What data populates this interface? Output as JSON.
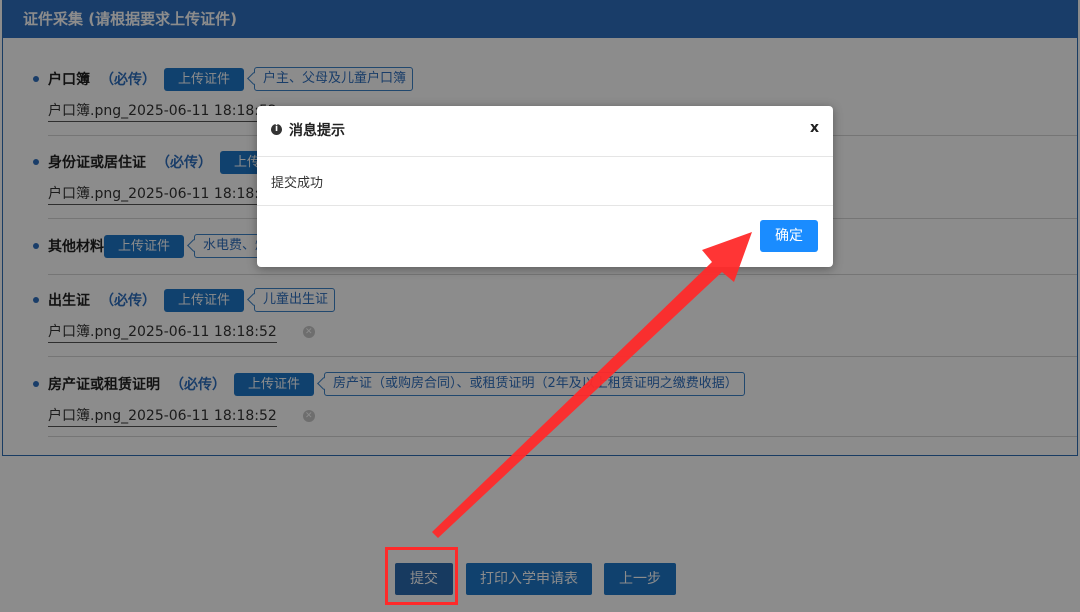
{
  "panel": {
    "title": "证件采集 (请根据要求上传证件)"
  },
  "sections": [
    {
      "name": "户口簿",
      "required": "（必传）",
      "upload_label": "上传证件",
      "hint": "户主、父母及儿童户口簿",
      "file": "户口簿.png_2025-06-11 18:18:52"
    },
    {
      "name": "身份证或居住证",
      "required": "（必传）",
      "upload_label": "上传证件",
      "hint": "",
      "file": "户口簿.png_2025-06-11 18:18:52"
    },
    {
      "name": "其他材料",
      "required": "",
      "upload_label": "上传证件",
      "hint": "水电费、煤",
      "file": ""
    },
    {
      "name": "出生证",
      "required": "（必传）",
      "upload_label": "上传证件",
      "hint": "儿童出生证",
      "file": "户口簿.png_2025-06-11 18:18:52"
    },
    {
      "name": "房产证或租赁证明",
      "required": "（必传）",
      "upload_label": "上传证件",
      "hint": "房产证（或购房合同）、或租赁证明（2年及以上租赁证明之缴费收据）",
      "file": "户口簿.png_2025-06-11 18:18:52"
    }
  ],
  "bottom": {
    "submit_label": "提交",
    "print_label": "打印入学申请表",
    "prev_label": "上一步"
  },
  "modal": {
    "icon": "info-icon",
    "title": "消息提示",
    "close": "x",
    "message": "提交成功",
    "ok_label": "确定"
  },
  "colors": {
    "header_blue": "#2f6fbf",
    "button_blue": "#1e77c8",
    "ok_blue": "#1a8cff",
    "annotation_red": "#ff2a2a"
  }
}
